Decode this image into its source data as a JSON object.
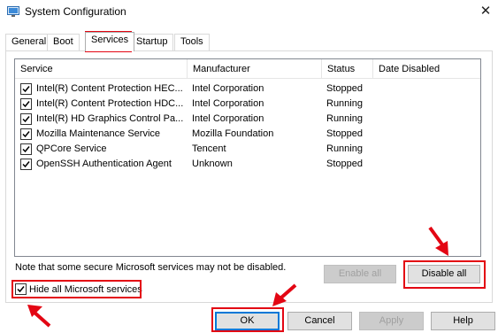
{
  "window": {
    "title": "System Configuration",
    "close_glyph": "✕"
  },
  "tabs": [
    {
      "label": "General",
      "active": false
    },
    {
      "label": "Boot",
      "active": false
    },
    {
      "label": "Services",
      "active": true
    },
    {
      "label": "Startup",
      "active": false
    },
    {
      "label": "Tools",
      "active": false
    }
  ],
  "services_table": {
    "columns": [
      "Service",
      "Manufacturer",
      "Status",
      "Date Disabled"
    ],
    "rows": [
      {
        "checked": true,
        "service": "Intel(R) Content Protection HEC...",
        "manufacturer": "Intel Corporation",
        "status": "Stopped",
        "date_disabled": ""
      },
      {
        "checked": true,
        "service": "Intel(R) Content Protection HDC...",
        "manufacturer": "Intel Corporation",
        "status": "Running",
        "date_disabled": ""
      },
      {
        "checked": true,
        "service": "Intel(R) HD Graphics Control Pa...",
        "manufacturer": "Intel Corporation",
        "status": "Running",
        "date_disabled": ""
      },
      {
        "checked": true,
        "service": "Mozilla Maintenance Service",
        "manufacturer": "Mozilla Foundation",
        "status": "Stopped",
        "date_disabled": ""
      },
      {
        "checked": true,
        "service": "QPCore Service",
        "manufacturer": "Tencent",
        "status": "Running",
        "date_disabled": ""
      },
      {
        "checked": true,
        "service": "OpenSSH Authentication Agent",
        "manufacturer": "Unknown",
        "status": "Stopped",
        "date_disabled": ""
      }
    ]
  },
  "note": "Note that some secure Microsoft services may not be disabled.",
  "buttons": {
    "enable_all": "Enable all",
    "disable_all": "Disable all",
    "ok": "OK",
    "cancel": "Cancel",
    "apply": "Apply",
    "help": "Help"
  },
  "hide_ms": {
    "checked": true,
    "label": "Hide all Microsoft services"
  },
  "colors": {
    "highlight_red": "#e30613",
    "focus_blue": "#0078d7"
  },
  "icons": [
    "system-configuration-icon",
    "close-icon",
    "checkbox-checked-icon",
    "red-arrow-icon"
  ]
}
